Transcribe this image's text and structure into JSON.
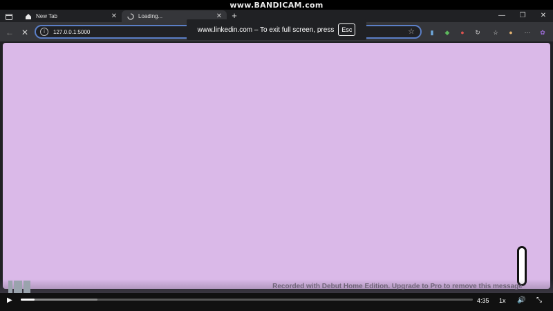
{
  "watermark": {
    "text": "www.BANDICAM.com"
  },
  "browser": {
    "tabs": [
      {
        "title": "New Tab",
        "icon": "home-icon",
        "close": "✕"
      },
      {
        "title": "Loading...",
        "icon": "loading-icon",
        "close": "✕"
      }
    ],
    "new_tab": "+",
    "window_controls": {
      "minimize": "—",
      "restore": "❐",
      "close": "✕"
    },
    "address_bar": {
      "url": "127.0.0.1:5000",
      "info_icon": "i",
      "star_icon": "☆"
    },
    "nav": {
      "back": "←",
      "stop": "✕"
    },
    "extensions": [
      {
        "name": "wallet-icon",
        "glyph": "▮",
        "color": "#6fa8dc"
      },
      {
        "name": "extension-green-icon",
        "glyph": "◆",
        "color": "#5cb85c"
      },
      {
        "name": "extension-red-icon",
        "glyph": "●",
        "color": "#d9534f"
      },
      {
        "name": "refresh-page-icon",
        "glyph": "↻",
        "color": "#cccccc"
      },
      {
        "name": "favorites-icon",
        "glyph": "☆",
        "color": "#cccccc"
      },
      {
        "name": "profile-avatar-icon",
        "glyph": "●",
        "color": "#e0b070"
      },
      {
        "name": "more-icon",
        "glyph": "⋯",
        "color": "#cccccc"
      },
      {
        "name": "copilot-icon",
        "glyph": "✿",
        "color": "#9b6bd6"
      }
    ]
  },
  "fullscreen_toast": {
    "message": "www.linkedin.com – To exit full screen, press",
    "key": "Esc"
  },
  "page": {
    "background": "#dab9e8"
  },
  "recording": {
    "message": "Recorded with Debut Home Edition. Upgrade to Pro to remove this message"
  },
  "player": {
    "play": "▶",
    "time": "4:35",
    "speed": "1x",
    "volume": "🔊",
    "fullscreen": "⤡",
    "progress": 0.03,
    "buffered": 0.17
  }
}
